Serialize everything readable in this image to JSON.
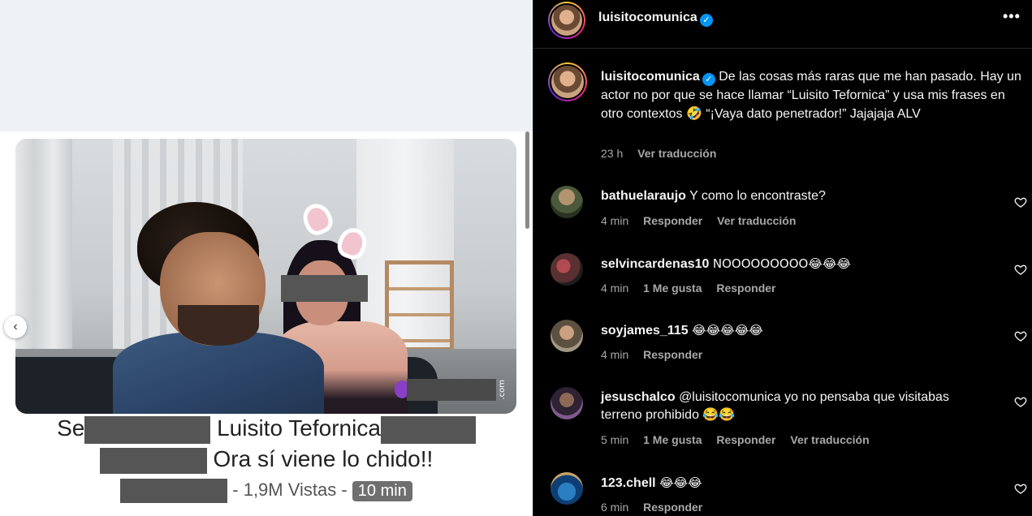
{
  "media": {
    "prev_label": "‹",
    "watermark": ".com",
    "caption_line1_start": "Se",
    "caption_line1_mid": " Luisito Tefornica",
    "caption_line2": " Ora sí viene lo chido!!",
    "caption_line3": " - 1,9M Vistas - ",
    "duration": "10 min"
  },
  "header": {
    "username": "luisitocomunica",
    "verified_glyph": "✓",
    "more_label": "•••"
  },
  "post": {
    "username": "luisitocomunica",
    "text": "De las cosas más raras que me han pasado. Hay un actor no por que se hace llamar “Luisito Tefornica” y usa mis frases en otro contextos 🤣 “¡Vaya dato penetrador!” Jajajaja ALV",
    "time": "23 h",
    "translate": "Ver traducción"
  },
  "comments": [
    {
      "username": "bathuelaraujo",
      "text": "Y como lo encontraste?",
      "time": "4 min",
      "likes": "",
      "reply": "Responder",
      "translate": "Ver traducción"
    },
    {
      "username": "selvincardenas10",
      "text": "NOOOOOOOOO😂😂😂",
      "time": "4 min",
      "likes": "1 Me gusta",
      "reply": "Responder",
      "translate": ""
    },
    {
      "username": "soyjames_115",
      "text": "😂😂😂😂😂",
      "time": "4 min",
      "likes": "",
      "reply": "Responder",
      "translate": ""
    },
    {
      "username": "jesuschalco",
      "text": "@luisitocomunica yo no pensaba que visitabas terreno prohibido 😂😂",
      "time": "5 min",
      "likes": "1 Me gusta",
      "reply": "Responder",
      "translate": "Ver traducción"
    },
    {
      "username": "123.chell",
      "text": "😂😂😂",
      "time": "6 min",
      "likes": "",
      "reply": "Responder",
      "translate": ""
    }
  ],
  "icons": {
    "heart": "heart-outline-icon",
    "verified": "verified-badge-icon",
    "more": "more-options-icon",
    "prev": "chevron-left-icon"
  },
  "colors": {
    "panel_bg": "#000000",
    "text_primary": "#f5f5f5",
    "text_secondary": "#a8a8a8",
    "verified": "#0095f6"
  }
}
